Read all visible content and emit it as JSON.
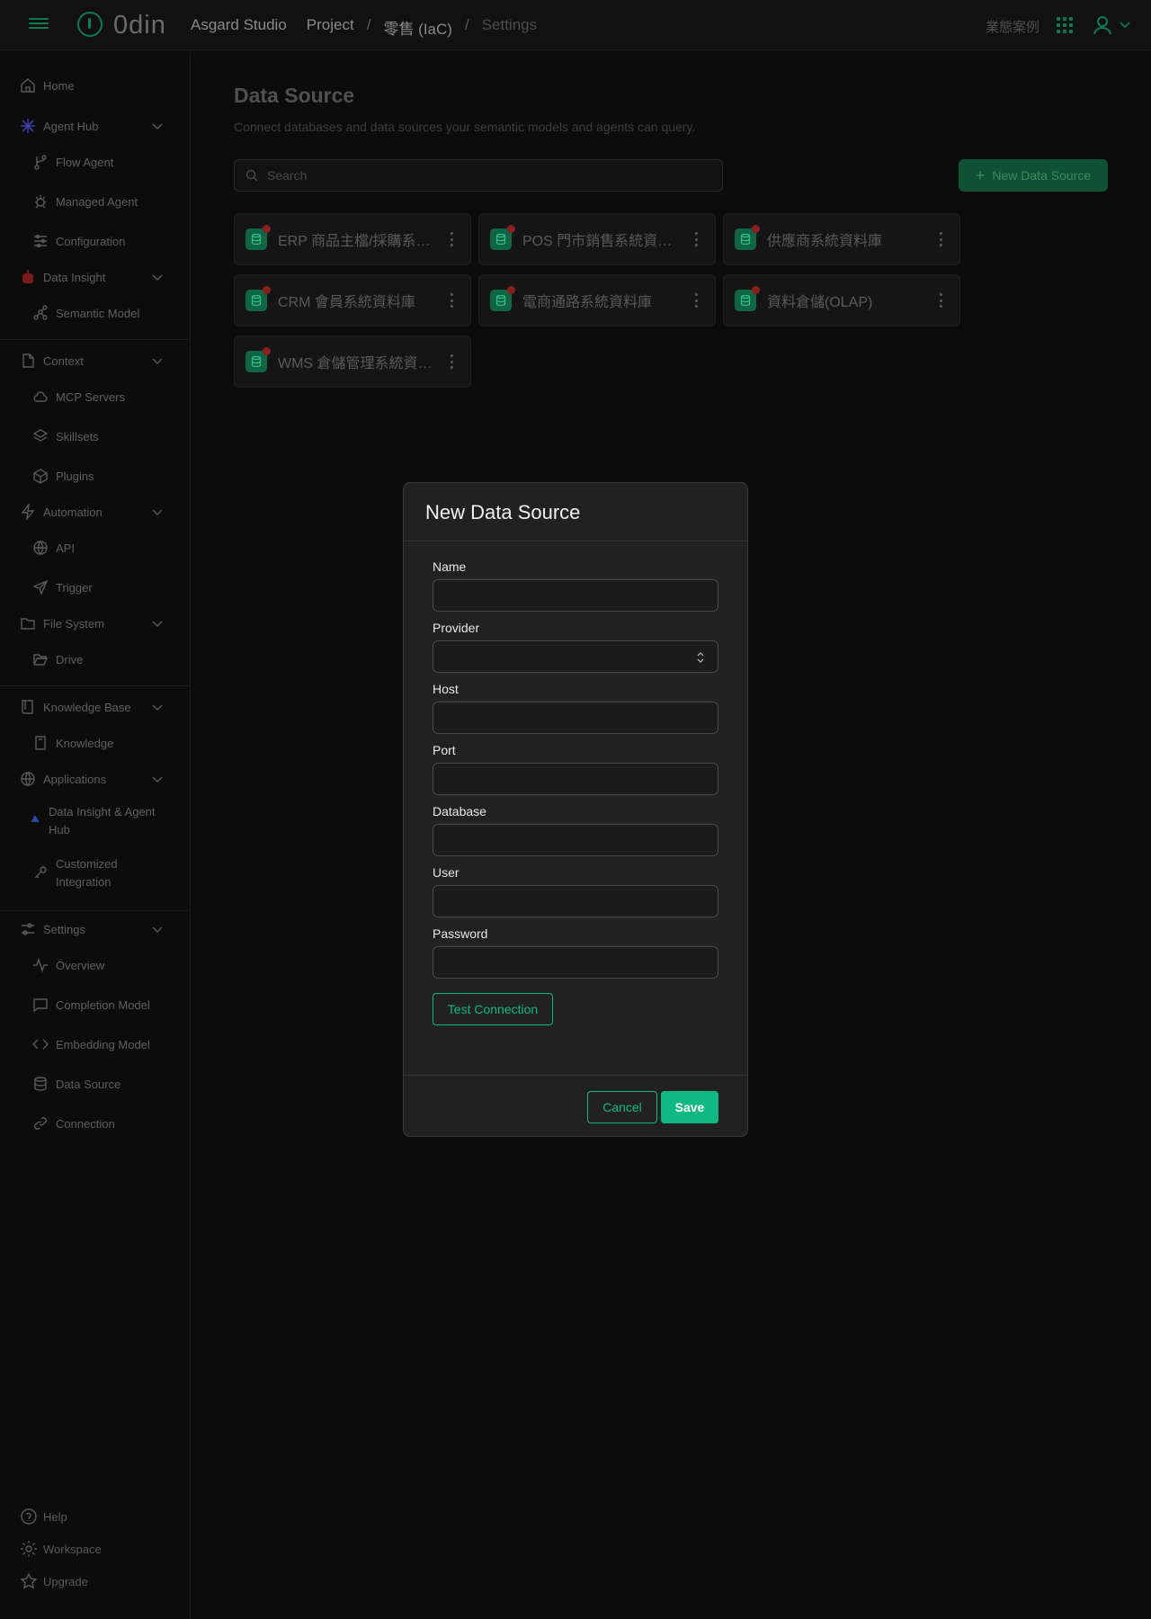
{
  "topbar": {
    "brand": "0din",
    "breadcrumbs": [
      "Asgard Studio",
      "Project",
      "零售 (IaC)",
      "Settings"
    ],
    "separator": "/",
    "right_text": "業態案例"
  },
  "sidebar": {
    "items": [
      {
        "label": "Home",
        "icon": "home-icon"
      },
      {
        "label": "Agent Hub",
        "icon": "sparkle-icon"
      },
      {
        "label": "Flow Agent",
        "icon": "branch-icon"
      },
      {
        "label": "Managed Agent",
        "icon": "bug-icon"
      },
      {
        "label": "Configuration",
        "icon": "sliders-icon"
      },
      {
        "label": "Data Insight",
        "icon": "robot-icon"
      },
      {
        "label": "Semantic Model",
        "icon": "graph-icon"
      },
      {
        "label": "Context",
        "icon": "document-icon"
      },
      {
        "label": "MCP Servers",
        "icon": "cloud-icon"
      },
      {
        "label": "Skillsets",
        "icon": "layers-icon"
      },
      {
        "label": "Plugins",
        "icon": "box-icon"
      },
      {
        "label": "Automation",
        "icon": "bolt-icon"
      },
      {
        "label": "API",
        "icon": "globe-icon"
      },
      {
        "label": "Trigger",
        "icon": "send-icon"
      },
      {
        "label": "File System",
        "icon": "folder-icon"
      },
      {
        "label": "Drive",
        "icon": "folder-open-icon"
      },
      {
        "label": "Knowledge Base",
        "icon": "book-icon"
      },
      {
        "label": "Knowledge",
        "icon": "book-open-icon"
      },
      {
        "label": "Applications",
        "icon": "globe-icon"
      },
      {
        "label": "Data Insight & Agent Hub",
        "icon": "triangle-icon"
      },
      {
        "label": "Customized Integration",
        "icon": "key-icon"
      },
      {
        "label": "Settings",
        "icon": "sliders-icon"
      },
      {
        "label": "Overview",
        "icon": "activity-icon"
      },
      {
        "label": "Completion Model",
        "icon": "chat-icon"
      },
      {
        "label": "Embedding Model",
        "icon": "code-icon"
      },
      {
        "label": "Data Source",
        "icon": "database-icon"
      },
      {
        "label": "Connection",
        "icon": "link-icon"
      }
    ],
    "footer": [
      {
        "label": "Help",
        "icon": "help-icon"
      },
      {
        "label": "Workspace",
        "icon": "gear-icon"
      },
      {
        "label": "Upgrade",
        "icon": "star-icon"
      }
    ]
  },
  "main": {
    "title": "Data Source",
    "subtitle": "Connect databases and data sources your semantic models and agents can query.",
    "search_placeholder": "Search",
    "new_button": "New Data Source",
    "cards": [
      "ERP 商品主檔/採購系統資料庫",
      "POS 門市銷售系統資料庫",
      "供應商系統資料庫",
      "CRM 會員系統資料庫",
      "電商通路系統資料庫",
      "資料倉儲(OLAP)",
      "WMS 倉儲管理系統資料庫"
    ]
  },
  "modal": {
    "title": "New Data Source",
    "fields": [
      {
        "label": "Name",
        "value": ""
      },
      {
        "label": "Provider",
        "value": ""
      },
      {
        "label": "Host",
        "value": ""
      },
      {
        "label": "Port",
        "value": ""
      },
      {
        "label": "Database",
        "value": ""
      },
      {
        "label": "User",
        "value": ""
      },
      {
        "label": "Password",
        "value": ""
      }
    ],
    "test_button": "Test Connection",
    "cancel_button": "Cancel",
    "save_button": "Save"
  },
  "colors": {
    "accent": "#10b981",
    "background": "#0c0c0c",
    "modal": "#212121",
    "status_dot": "#8b1f1f"
  }
}
